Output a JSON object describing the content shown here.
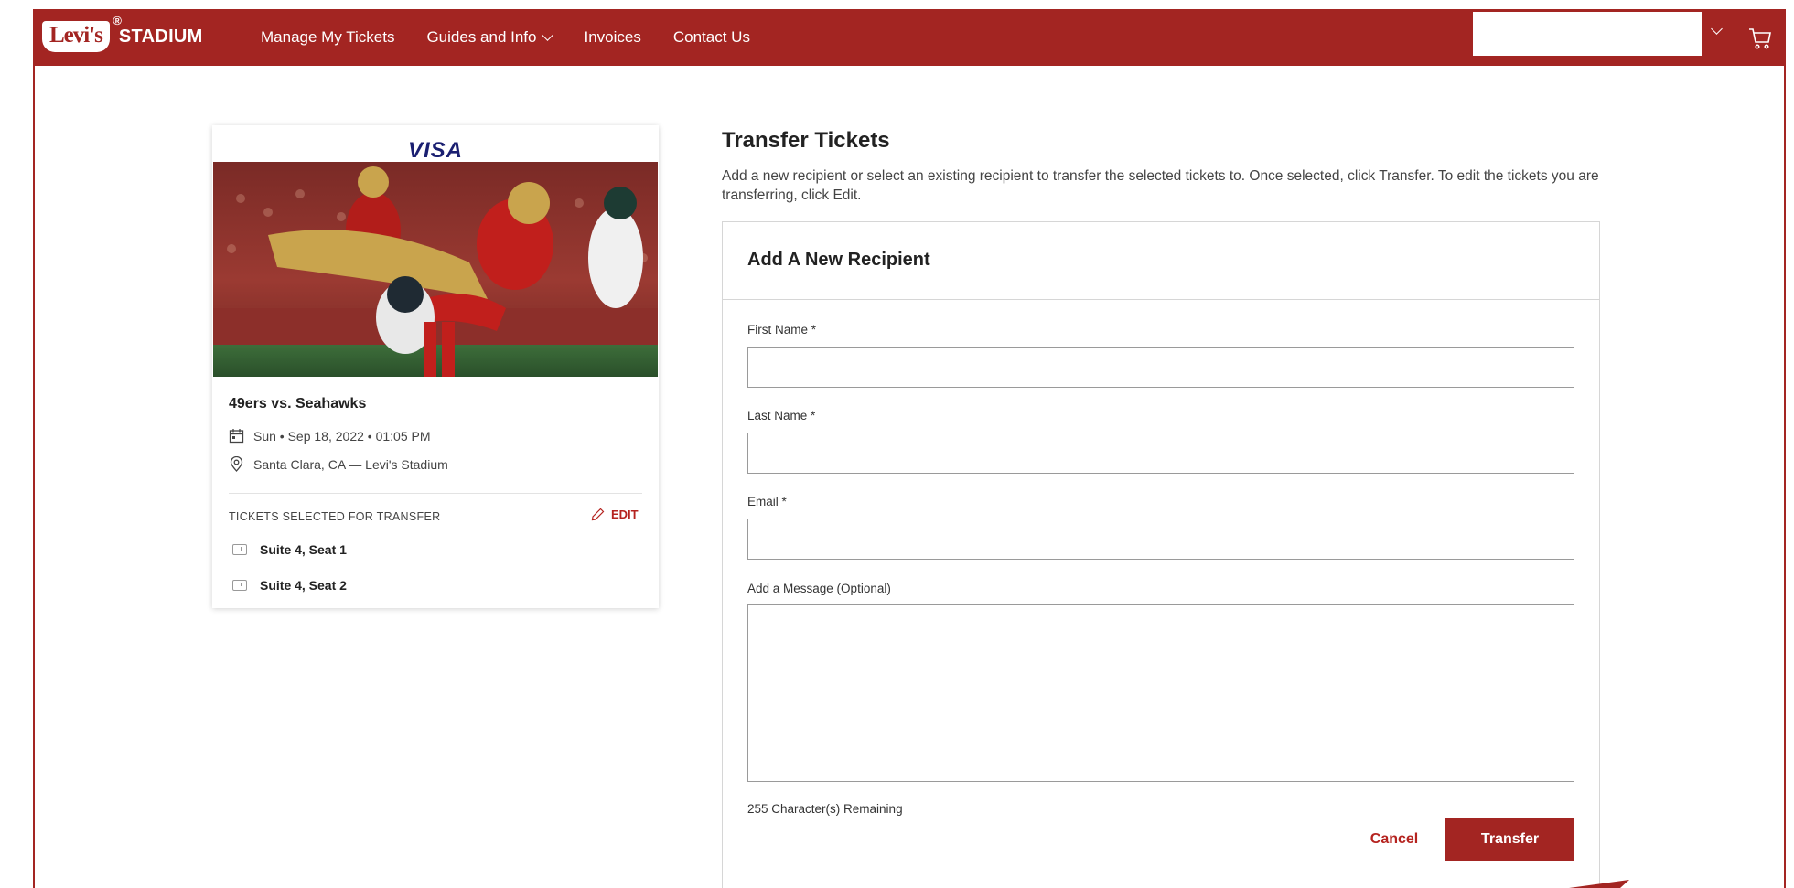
{
  "brand": {
    "logo_text": "Levi's",
    "logo_reg": "®",
    "stadium_text": "STADIUM",
    "accent": "#a32522"
  },
  "nav": {
    "items": [
      {
        "label": "Manage My Tickets"
      },
      {
        "label": "Guides and Info"
      },
      {
        "label": "Invoices"
      },
      {
        "label": "Contact Us"
      }
    ]
  },
  "event": {
    "sponsor": "VISA",
    "title": "49ers vs. Seahawks",
    "date": "Sun • Sep 18, 2022 • 01:05 PM",
    "location": "Santa Clara, CA — Levi's Stadium",
    "tickets_heading": "TICKETS SELECTED FOR TRANSFER",
    "edit_label": "EDIT",
    "tickets": [
      {
        "label": "Suite 4, Seat 1"
      },
      {
        "label": "Suite 4, Seat 2"
      }
    ]
  },
  "transfer": {
    "title": "Transfer Tickets",
    "description": "Add a new recipient or select an existing recipient to transfer the selected tickets to. Once selected, click Transfer. To edit the tickets you are transferring, click Edit.",
    "panel_title": "Add A New Recipient",
    "fields": {
      "first_name": {
        "label": "First Name *",
        "value": ""
      },
      "last_name": {
        "label": "Last Name *",
        "value": ""
      },
      "email": {
        "label": "Email *",
        "value": ""
      },
      "message": {
        "label": "Add a Message (Optional)",
        "value": ""
      }
    },
    "char_remaining": "255 Character(s) Remaining",
    "cancel_label": "Cancel",
    "transfer_label": "Transfer"
  }
}
